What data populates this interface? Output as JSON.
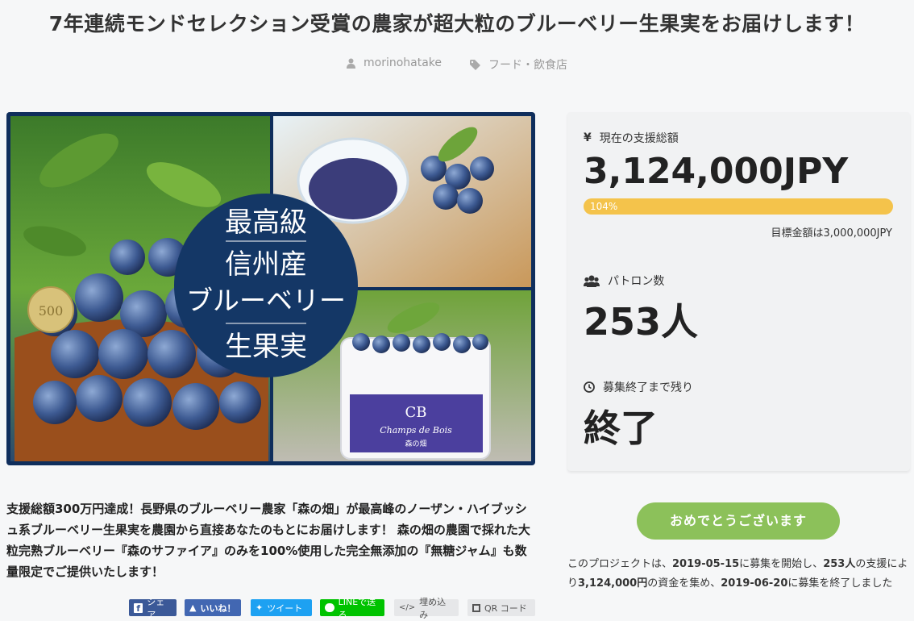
{
  "project": {
    "title": "7年連続モンドセレクション受賞の農家が超大粒のブルーベリー生果実をお届けします！",
    "author": "morinohatake",
    "category": "フード・飲食店",
    "description": "支援総額300万円達成！長野県のブルーベリー農家「森の畑」が最高峰のノーザン・ハイブッシュ系ブルーベリー生果実を農園から直接あなたのもとにお届けします！ 森の畑の農園で採れた大粒完熟ブルーベリー『森のサファイア』のみを100%使用した完全無添加の『無糖ジャム』も数量限定でご提供いたします！"
  },
  "hero": {
    "badge_line1": "最高級",
    "badge_line2": "信州産",
    "badge_line3": "ブルーベリー",
    "badge_line4": "生果実",
    "coin_text": "500",
    "box_logo": "CB",
    "box_brand": "Champs de Bois",
    "box_sub": "森の畑"
  },
  "stats": {
    "amount_label": "現在の支援総額",
    "amount_icon": "yen-icon",
    "amount_value": "3,124,000JPY",
    "progress_percent_label": "104%",
    "progress_fraction": 1.04,
    "goal_text": "目標金額は3,000,000JPY",
    "patrons_label": "パトロン数",
    "patrons_icon": "users-icon",
    "patrons_value": "253人",
    "remaining_label": "募集終了まで残り",
    "remaining_icon": "clock-icon",
    "remaining_value": "終了"
  },
  "actions": {
    "congrats_label": "おめでとうございます"
  },
  "summary": {
    "p1": "このプロジェクトは、",
    "start_date": "2019-05-15",
    "p2": "に募集を開始し、",
    "patrons": "253人",
    "p3": "の支援により",
    "amount": "3,124,000円",
    "p4": "の資金を集め、",
    "end_date": "2019-06-20",
    "p5": "に募集を終了しました"
  },
  "share": {
    "facebook": "シェア",
    "like": "いいね！",
    "tweet": "ツイート",
    "line": "LINEで送る",
    "embed": "埋め込み",
    "qr": "QR コード"
  },
  "colors": {
    "progress": "#f4c34b",
    "congrats": "#8cc15a",
    "facebook": "#3b5998",
    "like": "#4267b2",
    "twitter": "#1da1f2",
    "line": "#00c300",
    "navy": "#0f2e5c"
  }
}
